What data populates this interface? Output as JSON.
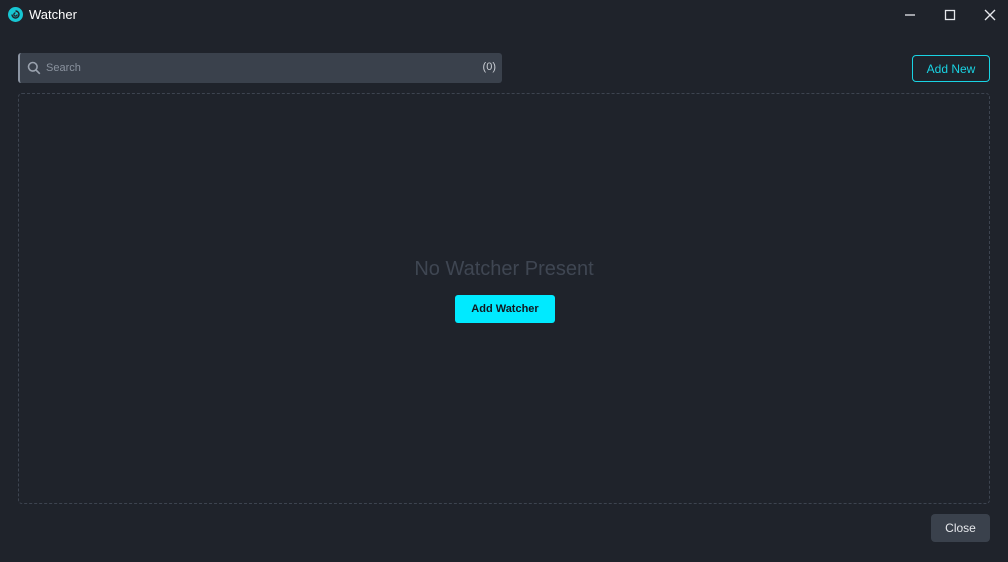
{
  "window": {
    "title": "Watcher",
    "controls": [
      "minimize-icon",
      "maximize-icon",
      "close-icon"
    ]
  },
  "search": {
    "placeholder": "Search",
    "value": "",
    "count": "(0)"
  },
  "toolbar": {
    "add_new_label": "Add New"
  },
  "empty_state": {
    "message": "No Watcher Present",
    "add_watcher_label": "Add Watcher"
  },
  "footer": {
    "close_label": "Close"
  },
  "colors": {
    "background": "#1f232b",
    "accent": "#00eaff",
    "input_bg": "#3a414c"
  }
}
